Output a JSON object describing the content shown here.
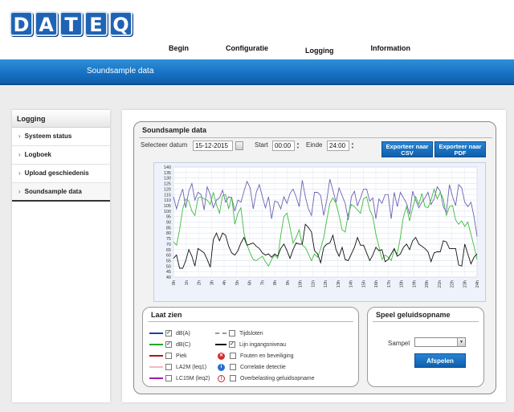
{
  "header": {
    "logo_letters": [
      "D",
      "A",
      "T",
      "E",
      "Q"
    ],
    "nav": [
      "Begin",
      "Configuratie",
      "Logging",
      "Information"
    ],
    "band_title": "Soundsample data"
  },
  "sidebar": {
    "title": "Logging",
    "items": [
      "Systeem status",
      "Logboek",
      "Upload geschiedenis",
      "Soundsample data"
    ]
  },
  "main": {
    "title": "Soundsample data",
    "select_date_label": "Selecteer datum",
    "date_value": "15-12-2015",
    "start_label": "Start",
    "start_value": "00:00",
    "end_label": "Einde",
    "end_value": "24:00",
    "export_csv": "Exporteer naar CSV",
    "export_pdf": "Exporteer naar PDF"
  },
  "chart_data": {
    "type": "line",
    "ylim": [
      40,
      140
    ],
    "y_ticks": [
      40,
      45,
      50,
      55,
      60,
      65,
      70,
      75,
      80,
      85,
      90,
      95,
      100,
      105,
      110,
      115,
      120,
      125,
      130,
      135,
      140
    ],
    "x_ticks": [
      "0h",
      "1h",
      "2h",
      "3h",
      "4h",
      "5h",
      "6h",
      "7h",
      "8h",
      "9h",
      "10h",
      "11h",
      "12h",
      "13h",
      "14h",
      "15h",
      "16h",
      "17h",
      "18h",
      "19h",
      "20h",
      "21h",
      "22h",
      "23h",
      "24h"
    ],
    "series": [
      {
        "color": "#6b63b5",
        "values": [
          113,
          102,
          112,
          120,
          103,
          118,
          125,
          110,
          117,
          115,
          101,
          122,
          115,
          103,
          110,
          112,
          119,
          108,
          113,
          112,
          100,
          110,
          108,
          118,
          127,
          121,
          102,
          117,
          124,
          113,
          103,
          113,
          93,
          109,
          108,
          102,
          113,
          107,
          116,
          120,
          113,
          104,
          128,
          113,
          102,
          96,
          117,
          117,
          114,
          96,
          110,
          129,
          119,
          108,
          121,
          114,
          107,
          92,
          113,
          118,
          105,
          112,
          120,
          120,
          109,
          112,
          93,
          111,
          107,
          115,
          115,
          93,
          117,
          104,
          117,
          112,
          107,
          97,
          118,
          110,
          103,
          108,
          112,
          117,
          106,
          111,
          122,
          118,
          104,
          99,
          124,
          113,
          105,
          124,
          121,
          108,
          104,
          108,
          95,
          77
        ]
      },
      {
        "color": "#3ebc3e",
        "values": [
          72,
          69,
          83,
          102,
          111,
          109,
          100,
          96,
          112,
          113,
          111,
          110,
          106,
          117,
          106,
          98,
          114,
          115,
          102,
          113,
          88,
          98,
          103,
          80,
          69,
          62,
          56,
          55,
          57,
          59,
          54,
          50,
          56,
          60,
          57,
          78,
          95,
          98,
          85,
          71,
          76,
          83,
          69,
          67,
          61,
          55,
          61,
          58,
          66,
          76,
          92,
          107,
          112,
          107,
          96,
          83,
          81,
          97,
          106,
          104,
          101,
          98,
          111,
          113,
          101,
          95,
          79,
          68,
          56,
          60,
          58,
          55,
          65,
          61,
          76,
          95,
          104,
          91,
          103,
          113,
          106,
          116,
          104,
          103,
          110,
          120,
          111,
          117,
          111,
          96,
          104,
          105,
          92,
          88,
          91,
          86,
          90,
          79,
          68,
          56
        ]
      },
      {
        "color": "#111111",
        "values": [
          57,
          60,
          48,
          48,
          55,
          65,
          59,
          50,
          66,
          64,
          62,
          56,
          49,
          74,
          80,
          73,
          80,
          78,
          68,
          62,
          60,
          64,
          71,
          76,
          69,
          70,
          71,
          68,
          66,
          62,
          60,
          61,
          58,
          61,
          59,
          66,
          70,
          64,
          57,
          65,
          71,
          70,
          70,
          88,
          85,
          81,
          64,
          61,
          53,
          67,
          70,
          71,
          78,
          65,
          59,
          67,
          56,
          55,
          61,
          67,
          76,
          69,
          69,
          62,
          55,
          60,
          67,
          64,
          65,
          54,
          56,
          61,
          66,
          59,
          61,
          67,
          70,
          65,
          73,
          76,
          70,
          68,
          66,
          63,
          54,
          62,
          63,
          63,
          73,
          72,
          66,
          66,
          66,
          51,
          50,
          70,
          61,
          52,
          58,
          61
        ]
      }
    ]
  },
  "show_panel": {
    "title": "Laat zien",
    "left": [
      {
        "label": "dB(A)",
        "color": "#1f3fa8",
        "checked": true
      },
      {
        "label": "dB(C)",
        "color": "#22a822",
        "checked": true
      },
      {
        "label": "Piek",
        "color": "#b01515",
        "checked": false
      },
      {
        "label": "LA2M (leq1)",
        "color": "#f2b8c6",
        "checked": false
      },
      {
        "label": "LC15M (leq2)",
        "color": "#a01ab0",
        "checked": false
      }
    ],
    "right": [
      {
        "label": "Tijdsloten",
        "marker": "dashed-gray",
        "checked": false
      },
      {
        "label": "Lijn ingangsniveau",
        "marker": "solid-black",
        "checked": true
      },
      {
        "label": "Fouten en beveiliging",
        "marker": "error-icon",
        "checked": false
      },
      {
        "label": "Correlatie detectie",
        "marker": "info-icon",
        "checked": false
      },
      {
        "label": "Overbelasting geluidsopname",
        "marker": "warning-icon",
        "checked": false
      }
    ]
  },
  "play_panel": {
    "title": "Speel geluidsopname",
    "sample_label": "Sampel",
    "play_button": "Afspelen"
  }
}
